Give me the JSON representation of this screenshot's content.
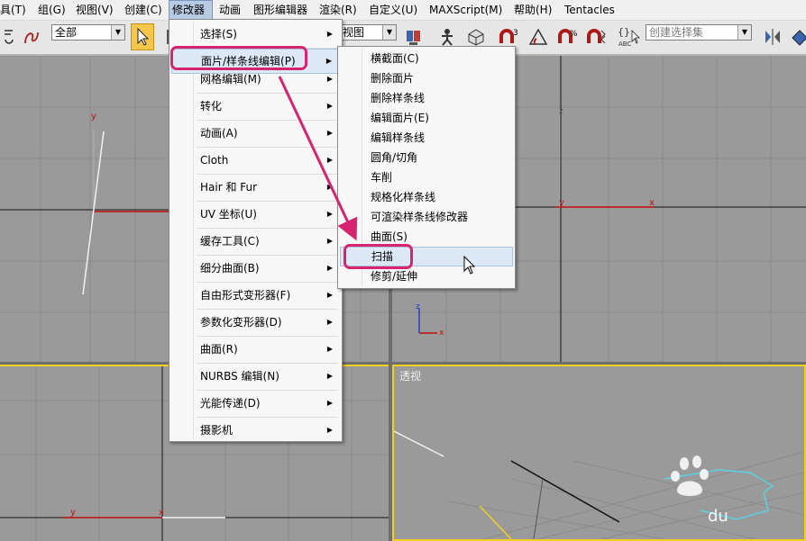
{
  "menubar": {
    "items": [
      "具(T)",
      "组(G)",
      "视图(V)",
      "创建(C)",
      "修改器",
      "动画",
      "图形编辑器",
      "渲染(R)",
      "自定义(U)",
      "MAXScript(M)",
      "帮助(H)",
      "Tentacles"
    ]
  },
  "toolbar": {
    "filter_value": "全部",
    "view_value": "视图",
    "selection_set_placeholder": "创建选择集",
    "abc_label": "ABC"
  },
  "viewports": {
    "perspective_label": "透视"
  },
  "modifiers_menu": {
    "items": [
      "选择(S)",
      "面片/样条线编辑(P)",
      "网格编辑(M)",
      "转化",
      "动画(A)",
      "Cloth",
      "Hair 和 Fur",
      "UV 坐标(U)",
      "缓存工具(C)",
      "细分曲面(B)",
      "自由形式变形器(F)",
      "参数化变形器(D)",
      "曲面(R)",
      "NURBS 编辑(N)",
      "光能传递(D)",
      "摄影机"
    ]
  },
  "patch_spline_submenu": {
    "items": [
      "横截面(C)",
      "删除面片",
      "删除样条线",
      "编辑面片(E)",
      "编辑样条线",
      "圆角/切角",
      "车削",
      "规格化样条线",
      "可渲染样条线修改器",
      "曲面(S)",
      "扫描",
      "修剪/延伸"
    ]
  },
  "axis_labels": {
    "x": "x",
    "y": "y",
    "z": "z"
  },
  "colors": {
    "highlight_ring": "#d6246e",
    "viewport_bg": "#9a9a9a",
    "active_viewport_border": "#f0d020"
  }
}
